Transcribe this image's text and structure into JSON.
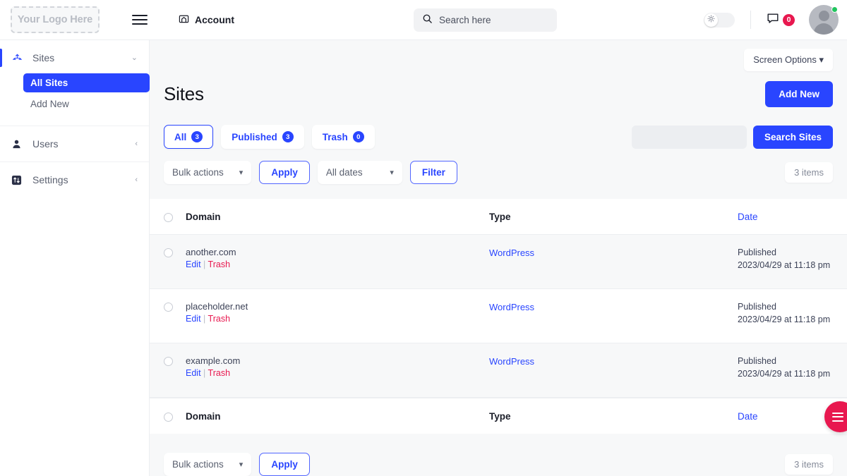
{
  "header": {
    "logo_text": "Your Logo Here",
    "menu_icon": "hamburger-icon",
    "account_label": "Account",
    "account_icon": "site-house-icon",
    "search_placeholder": "Search here",
    "search_icon": "search-icon",
    "theme_toggle_icon": "sun-icon",
    "messages_icon": "comment-icon",
    "messages_badge": "0",
    "avatar_icon": "user-avatar",
    "status": "online"
  },
  "sidebar": {
    "items": [
      {
        "label": "Sites",
        "icon": "sites-icon",
        "chevron": "⌄",
        "active": true
      },
      {
        "label": "Users",
        "icon": "users-icon",
        "chevron": "‹",
        "active": false
      },
      {
        "label": "Settings",
        "icon": "settings-sliders-icon",
        "chevron": "‹",
        "active": false
      }
    ],
    "sites_children": [
      {
        "label": "All Sites",
        "active": true
      },
      {
        "label": "Add New",
        "active": false
      }
    ]
  },
  "main": {
    "screen_options_label": "Screen Options",
    "screen_options_caret": "▾",
    "page_title": "Sites",
    "add_new_label": "Add New",
    "status_tabs": [
      {
        "label": "All",
        "count": "3",
        "active": true
      },
      {
        "label": "Published",
        "count": "3",
        "active": false
      },
      {
        "label": "Trash",
        "count": "0",
        "active": false
      }
    ],
    "search": {
      "value": "",
      "placeholder": "",
      "button_label": "Search Sites"
    },
    "bulk_actions_label": "Bulk actions",
    "apply_label": "Apply",
    "dates_label": "All dates",
    "filter_label": "Filter",
    "items_count": "3 items",
    "items_count_footer": "3 items",
    "bulk_actions_label_footer": "Bulk actions",
    "apply_label_footer": "Apply"
  },
  "table": {
    "columns": {
      "domain": "Domain",
      "type": "Type",
      "date": "Date"
    },
    "footer_columns": {
      "domain": "Domain",
      "type": "Type",
      "date": "Date"
    },
    "row_action_edit": "Edit",
    "row_action_separator": "|",
    "row_action_trash": "Trash",
    "rows": [
      {
        "domain": "another.com",
        "type": "WordPress",
        "date_status": "Published",
        "date_value": "2023/04/29 at 11:18 pm"
      },
      {
        "domain": "placeholder.net",
        "type": "WordPress",
        "date_status": "Published",
        "date_value": "2023/04/29 at 11:18 pm"
      },
      {
        "domain": "example.com",
        "type": "WordPress",
        "date_status": "Published",
        "date_value": "2023/04/29 at 11:18 pm"
      }
    ]
  },
  "fab": {
    "icon": "hamburger-icon"
  },
  "colors": {
    "accent_blue": "#2945ff",
    "danger_red": "#e8184f",
    "online_green": "#20c55e",
    "page_bg": "#f7f8f9"
  }
}
